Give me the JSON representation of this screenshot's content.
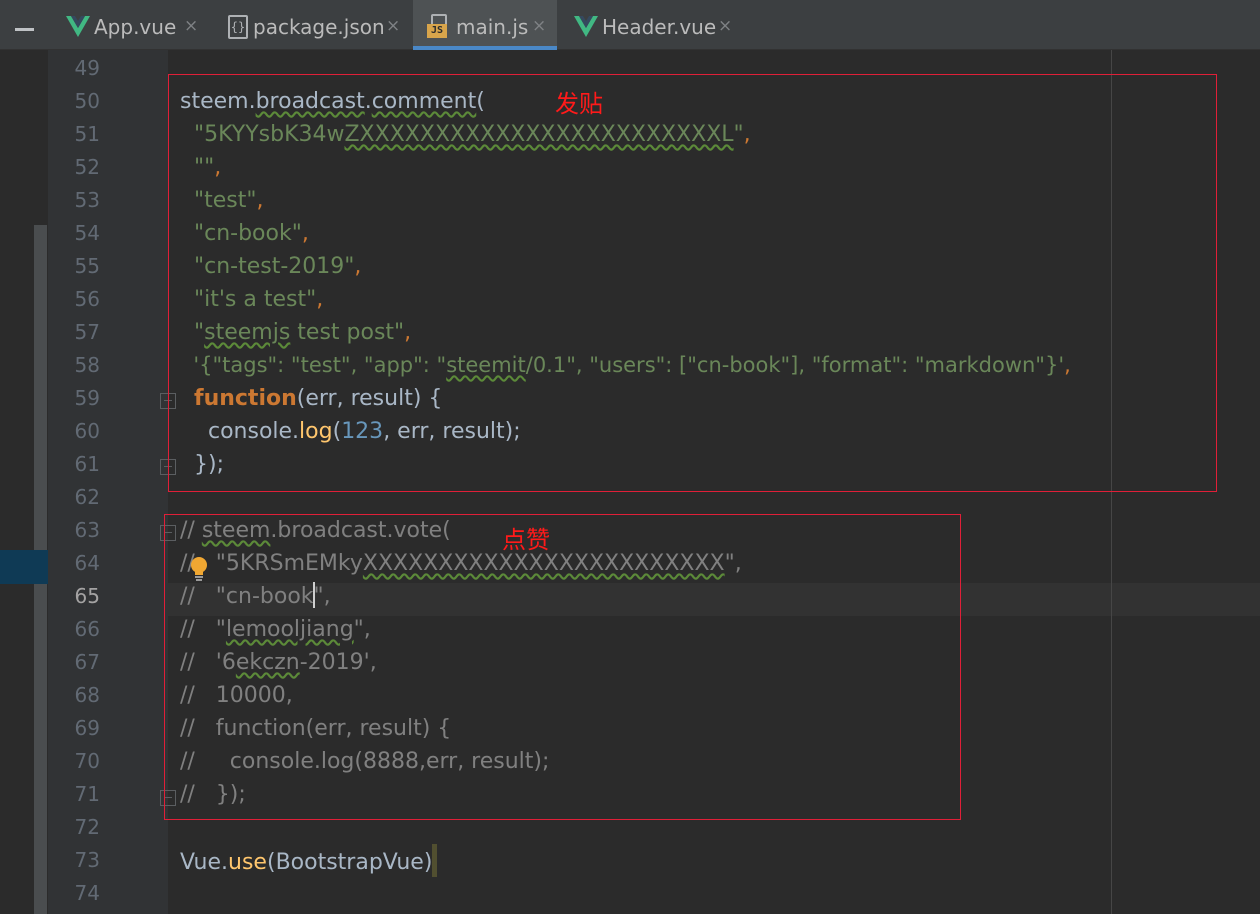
{
  "tabs": [
    {
      "label": "App.vue",
      "icon": "vue-icon"
    },
    {
      "label": "package.json",
      "icon": "json-file-icon"
    },
    {
      "label": "main.js",
      "icon": "js-file-icon",
      "active": true
    },
    {
      "label": "Header.vue",
      "icon": "vue-icon"
    }
  ],
  "tab_close_glyph": "×",
  "json_icon_glyph": "{}",
  "js_badge": "JS",
  "line_numbers": [
    "49",
    "50",
    "51",
    "52",
    "53",
    "54",
    "55",
    "56",
    "57",
    "58",
    "59",
    "60",
    "61",
    "62",
    "63",
    "64",
    "65",
    "66",
    "67",
    "68",
    "69",
    "70",
    "71",
    "72",
    "73",
    "74"
  ],
  "current_line": "65",
  "code": {
    "l50": {
      "a": "steem.",
      "b": "broadcast",
      "c": ".",
      "d": "comment",
      "e": "("
    },
    "l51": {
      "indent": "  ",
      "a": "\"5KYYsbK34w",
      "b": "ZXXXXXXXXXXXXXXXXXXXXXXXXL",
      "c": "\"",
      "d": ","
    },
    "l52": {
      "indent": "  ",
      "a": "\"\"",
      "b": ","
    },
    "l53": {
      "indent": "  ",
      "a": "\"test\"",
      "b": ","
    },
    "l54": {
      "indent": "  ",
      "a": "\"cn-book\"",
      "b": ","
    },
    "l55": {
      "indent": "  ",
      "a": "\"cn-test-2019\"",
      "b": ","
    },
    "l56": {
      "indent": "  ",
      "a": "\"it's a test\"",
      "b": ","
    },
    "l57": {
      "indent": "  ",
      "a": "\"",
      "b": "steemjs",
      "c": " test post\"",
      "d": ","
    },
    "l58": {
      "indent": "  ",
      "a": "'{\"tags\": \"test\", \"app\": \"",
      "b": "steemit",
      "c": "/0.1\", \"users\": [\"cn-book\"], \"format\": \"markdown\"}'",
      "d": ","
    },
    "l59": {
      "indent": "  ",
      "a": "function",
      "b": "(err, result) {"
    },
    "l60": {
      "indent": "    ",
      "a": "console.",
      "b": "log",
      "c": "(",
      "d": "123",
      "e": ", err, result);"
    },
    "l61": {
      "indent": "  ",
      "a": "});"
    },
    "l63": {
      "a": "// ",
      "b": "steem",
      "c": ".broadcast.vote("
    },
    "l64": {
      "a": "//",
      "b": "   \"5KRSmEMky",
      "c": "XXXXXXXXXXXXXXXXXXXXXXXX",
      "d": "\","
    },
    "l65": {
      "a": "//   \"cn-book",
      "b": "\","
    },
    "l66": {
      "a": "//   \"",
      "b": "lemooljiang",
      "c": "\","
    },
    "l67": {
      "a": "//   '6",
      "b": "ekczn",
      "c": "-2019',"
    },
    "l68": {
      "a": "//   10000,"
    },
    "l69": {
      "a": "//   function(err, result) {"
    },
    "l70": {
      "a": "//     console.log(8888,err, result);"
    },
    "l71": {
      "a": "//   });"
    },
    "l73": {
      "a": "Vue.",
      "b": "use",
      "c": "(BootstrapVue)"
    }
  },
  "annotations": {
    "post": "发贴",
    "like": "点赞"
  },
  "colors": {
    "string": "#6a8759",
    "keyword": "#cc7832",
    "function": "#ffc66d",
    "number": "#6897bb",
    "comment": "#808080",
    "annotation": "#ff1a1a"
  }
}
